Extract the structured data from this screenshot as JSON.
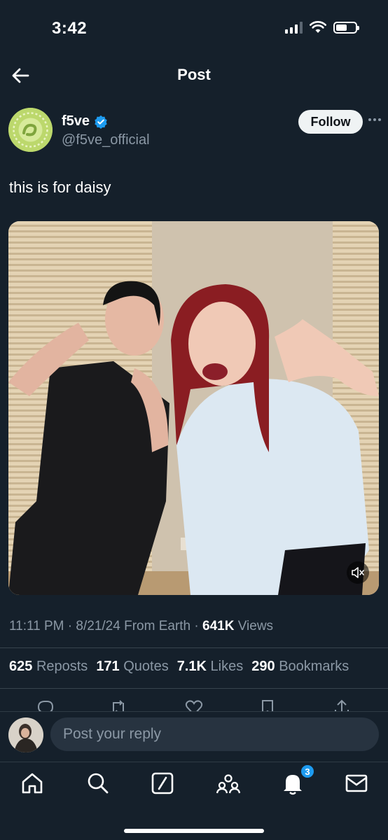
{
  "status_bar": {
    "time": "3:42"
  },
  "header": {
    "title": "Post"
  },
  "author": {
    "name": "f5ve",
    "handle": "@f5ve_official",
    "follow_label": "Follow"
  },
  "post": {
    "text": "this is for daisy",
    "time": "11:11 PM",
    "date": "8/21/24",
    "source": "From Earth",
    "views_count": "641K",
    "views_label": "Views"
  },
  "stats": [
    {
      "count": "625",
      "label": "Reposts"
    },
    {
      "count": "171",
      "label": "Quotes"
    },
    {
      "count": "7.1K",
      "label": "Likes"
    },
    {
      "count": "290",
      "label": "Bookmarks"
    }
  ],
  "reply": {
    "placeholder": "Post your reply"
  },
  "tab_bar": {
    "items": [
      "home-icon",
      "search-icon",
      "grok-icon",
      "communities-icon",
      "notifications-icon",
      "messages-icon"
    ],
    "notifications_badge": "3"
  },
  "colors": {
    "background": "#15202b",
    "accent": "#1d9bf0",
    "muted_text": "#8b98a5",
    "divider": "#38444d"
  }
}
